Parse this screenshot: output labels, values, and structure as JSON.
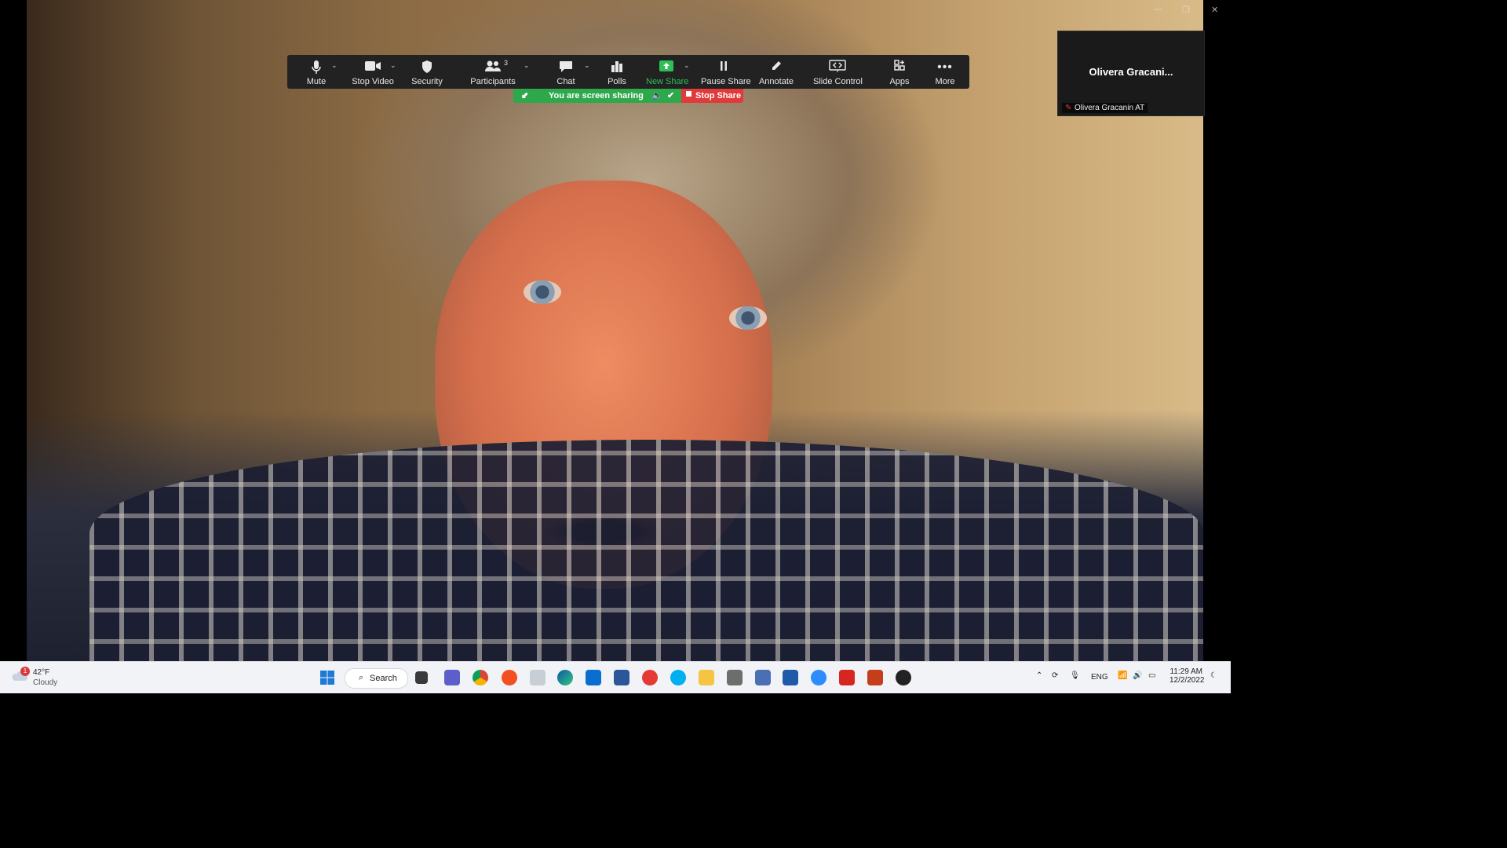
{
  "toolbar": {
    "mute": "Mute",
    "stop_video": "Stop Video",
    "security": "Security",
    "participants": "Participants",
    "participants_count": "3",
    "chat": "Chat",
    "polls": "Polls",
    "new_share": "New Share",
    "pause_share": "Pause Share",
    "annotate": "Annotate",
    "slide_control": "Slide Control",
    "apps": "Apps",
    "more": "More"
  },
  "share_bar": {
    "status": "You are screen sharing",
    "stop": "Stop Share"
  },
  "thumbnail": {
    "display_name": "Olivera  Gracani...",
    "name_tag": "Olivera Gracanin AT"
  },
  "taskbar": {
    "weather_temp": "42°F",
    "weather_desc": "Cloudy",
    "weather_badge": "1",
    "search_label": "Search",
    "language": "ENG",
    "time": "11:29 AM",
    "date": "12/2/2022"
  },
  "colors": {
    "share_green": "#2da84b",
    "stop_red": "#e03a3a",
    "new_share_green": "#2fbf57",
    "toolbar_bg": "#222222"
  }
}
